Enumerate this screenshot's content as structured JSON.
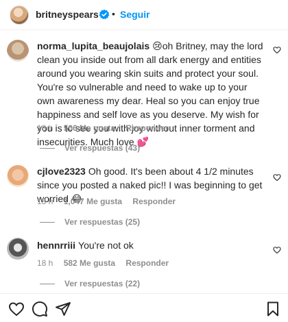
{
  "header": {
    "username": "britneyspears",
    "separator": "•",
    "follow_label": "Seguir"
  },
  "comments": [
    {
      "username": "norma_lupita_beaujolais",
      "text": "😢oh Britney, may the lord clean you inside out from all dark energy and entities around you wearing skin suits and protect your soul. You're so vulnerable and need to wake up to your own awareness my dear. Heal so you can enjoy true happiness and self love as you deserve. My wish for you is to see you with joy without inner torment and insecurities. Much love 💕",
      "time": "18 h",
      "likes": "506 Me gusta",
      "reply_label": "Responder",
      "view_replies": "Ver respuestas (43)"
    },
    {
      "username": "cjlove2323",
      "text": "Oh good. It's been about 4 1/2 minutes since you posted a naked pic!! I was beginning to get worried 😂",
      "time": "18 h",
      "likes": "1,047 Me gusta",
      "reply_label": "Responder",
      "view_replies": "Ver respuestas (25)"
    },
    {
      "username": "hennrriii",
      "text": "You're not ok",
      "time": "18 h",
      "likes": "582 Me gusta",
      "reply_label": "Responder",
      "view_replies": "Ver respuestas (22)"
    }
  ],
  "icons": {
    "like": "heart-icon",
    "comment": "comment-icon",
    "share": "share-icon",
    "save": "bookmark-icon",
    "verified": "verified-badge-icon"
  },
  "colors": {
    "accent": "#0095f6",
    "muted": "#8e8e8e"
  }
}
